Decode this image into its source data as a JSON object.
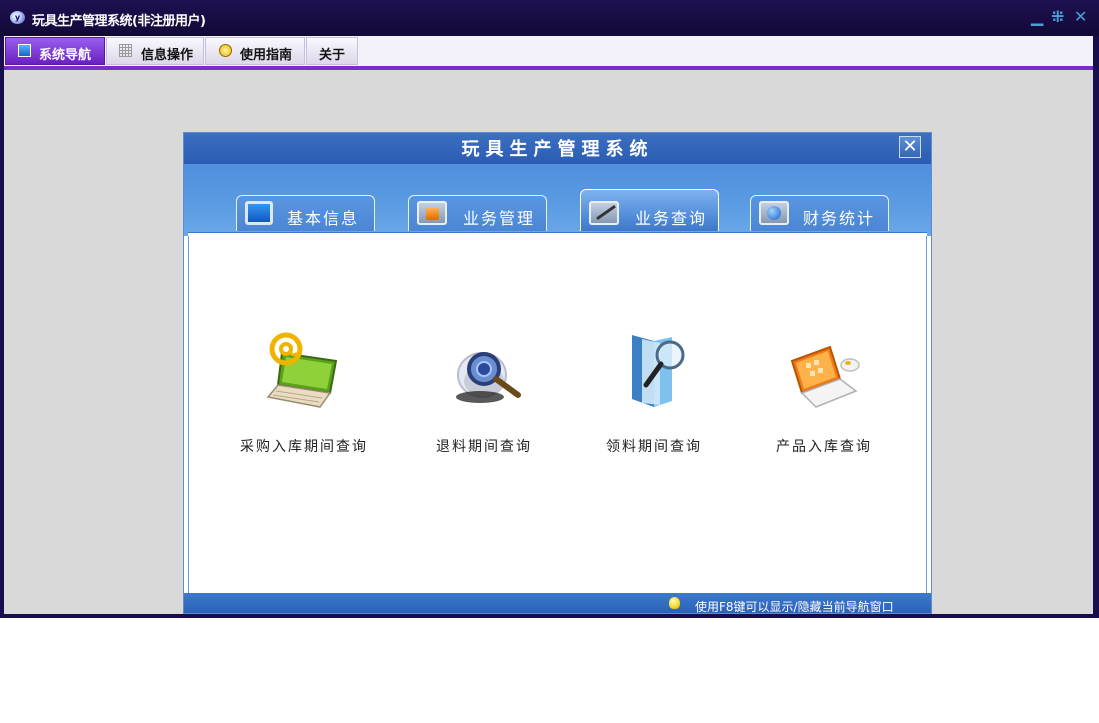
{
  "window": {
    "title": "玩具生产管理系统(非注册用户)",
    "controls": [
      "minimize-icon",
      "restore-icon",
      "close-icon"
    ]
  },
  "menu": {
    "tabs": [
      {
        "label": "系统导航",
        "icon": "monitor-icon",
        "active": true
      },
      {
        "label": "信息操作",
        "icon": "grid-icon",
        "active": false
      },
      {
        "label": "使用指南",
        "icon": "help-icon",
        "active": false
      },
      {
        "label": "关于",
        "icon": "",
        "active": false
      }
    ]
  },
  "dialog": {
    "title": "玩具生产管理系统",
    "tabs": [
      {
        "label": "基本信息",
        "icon": "monitor-icon",
        "active": false
      },
      {
        "label": "业务管理",
        "icon": "rss-folder-icon",
        "active": false
      },
      {
        "label": "业务查询",
        "icon": "pen-folder-icon",
        "active": true
      },
      {
        "label": "财务统计",
        "icon": "globe-folder-icon",
        "active": false
      }
    ],
    "items": [
      {
        "label": "采购入库期间查询",
        "icon": "email-laptop-icon"
      },
      {
        "label": "退料期间查询",
        "icon": "magnifier-disc-icon"
      },
      {
        "label": "领料期间查询",
        "icon": "magnifier-book-icon"
      },
      {
        "label": "产品入库查询",
        "icon": "laptop-mouse-icon"
      }
    ],
    "status_text": "使用F8键可以显示/隐藏当前导航窗口",
    "colors": {
      "header": "#2a5cb3",
      "tab_strip": "#5c9ce3",
      "accent": "#7a2dc8",
      "titlebar": "#1a0d4d"
    }
  }
}
